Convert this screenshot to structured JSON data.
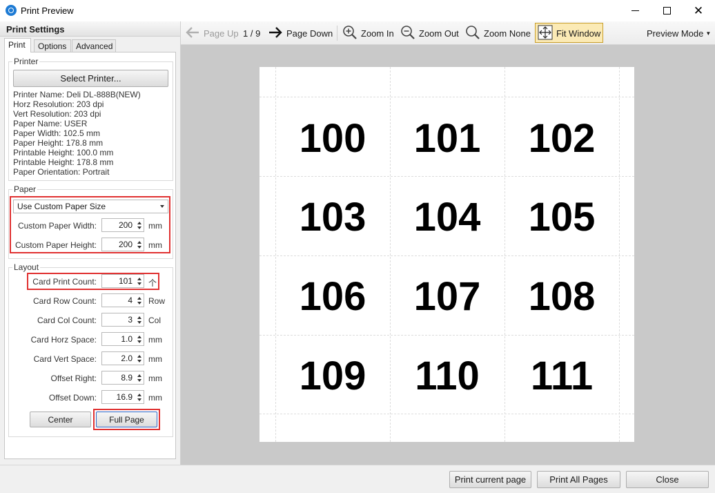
{
  "window": {
    "title": "Print Preview"
  },
  "settings": {
    "header": "Print Settings",
    "tabs": [
      "Print",
      "Options",
      "Advanced"
    ],
    "printer": {
      "group_label": "Printer",
      "select_button": "Select Printer...",
      "info": [
        "Printer Name: Deli DL-888B(NEW)",
        "Horz Resolution: 203 dpi",
        "Vert Resolution: 203 dpi",
        "Paper Name: USER",
        "Paper Width: 102.5 mm",
        "Paper Height: 178.8 mm",
        "Printable Height: 100.0 mm",
        "Printable Height: 178.8 mm",
        "Paper Orientation: Portrait"
      ]
    },
    "paper": {
      "group_label": "Paper",
      "size_option": "Use Custom Paper Size",
      "width_label": "Custom Paper Width:",
      "width_value": "200",
      "height_label": "Custom Paper Height:",
      "height_value": "200",
      "unit": "mm"
    },
    "layout": {
      "group_label": "Layout",
      "fields": [
        {
          "label": "Card Print Count:",
          "value": "101",
          "unit": "个"
        },
        {
          "label": "Card Row Count:",
          "value": "4",
          "unit": "Row"
        },
        {
          "label": "Card Col Count:",
          "value": "3",
          "unit": "Col"
        },
        {
          "label": "Card Horz Space:",
          "value": "1.0",
          "unit": "mm"
        },
        {
          "label": "Card Vert Space:",
          "value": "2.0",
          "unit": "mm"
        },
        {
          "label": "Offset Right:",
          "value": "8.9",
          "unit": "mm"
        },
        {
          "label": "Offset Down:",
          "value": "16.9",
          "unit": "mm"
        }
      ],
      "center_button": "Center",
      "full_page_button": "Full Page"
    }
  },
  "toolbar": {
    "page_up": "Page Up",
    "page_indicator": "1 / 9",
    "page_down": "Page Down",
    "zoom_in": "Zoom In",
    "zoom_out": "Zoom Out",
    "zoom_none": "Zoom None",
    "fit_window": "Fit Window",
    "preview_mode": "Preview Mode"
  },
  "preview": {
    "cards": [
      "100",
      "101",
      "102",
      "103",
      "104",
      "105",
      "106",
      "107",
      "108",
      "109",
      "110",
      "111"
    ]
  },
  "footer": {
    "print_current": "Print current page",
    "print_all": "Print All Pages",
    "close": "Close"
  }
}
